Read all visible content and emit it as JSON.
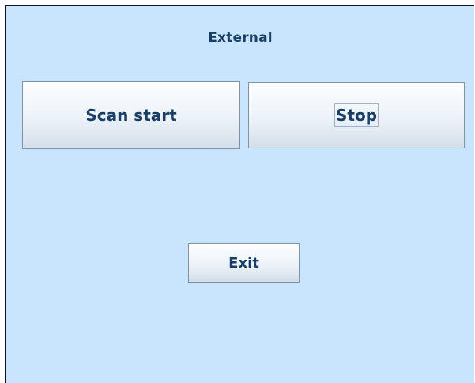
{
  "window": {
    "title": "External"
  },
  "buttons": {
    "scan_start": "Scan start",
    "stop": "Stop",
    "exit": "Exit"
  },
  "colors": {
    "background": "#c9e5fd",
    "text": "#1a3f66",
    "button_border": "#7f93a8"
  }
}
